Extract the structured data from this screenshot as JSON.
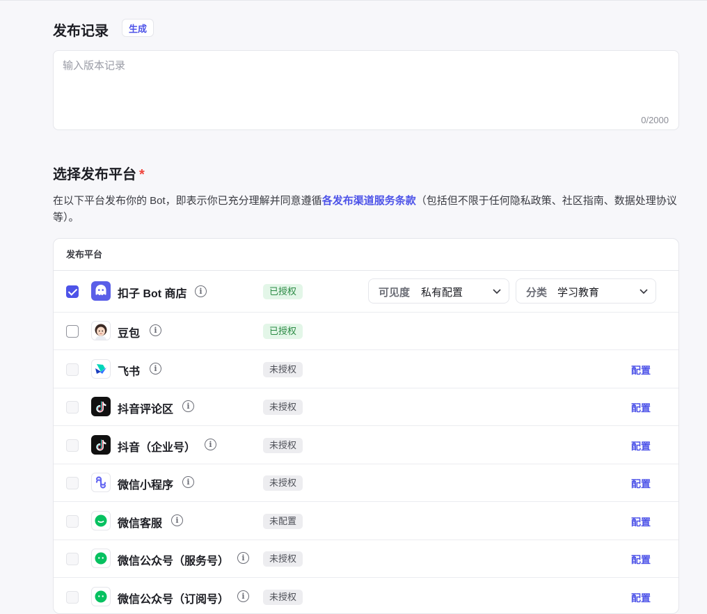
{
  "release_notes": {
    "title": "发布记录",
    "generate_label": "生成",
    "placeholder": "输入版本记录",
    "counter": "0/2000"
  },
  "platform_section": {
    "title": "选择发布平台",
    "required_mark": "*",
    "description_before": "在以下平台发布你的 Bot，即表示你已充分理解并同意遵循",
    "terms_link": "各发布渠道服务条款",
    "description_after": "（包括但不限于任何隐私政策、社区指南、数据处理协议等）。",
    "table_header": "发布平台",
    "config_label": "配置",
    "visibility": {
      "label": "可见度",
      "value": "私有配置"
    },
    "category": {
      "label": "分类",
      "value": "学习教育"
    },
    "platforms": [
      {
        "name": "扣子 Bot 商店",
        "status": "已授权",
        "checked": true,
        "icon": "coze-bot-icon"
      },
      {
        "name": "豆包",
        "status": "已授权",
        "checked": false,
        "icon": "doubao-avatar-icon"
      },
      {
        "name": "飞书",
        "status": "未授权",
        "checked": false,
        "icon": "feishu-icon"
      },
      {
        "name": "抖音评论区",
        "status": "未授权",
        "checked": false,
        "icon": "douyin-icon"
      },
      {
        "name": "抖音（企业号）",
        "status": "未授权",
        "checked": false,
        "icon": "douyin-icon"
      },
      {
        "name": "微信小程序",
        "status": "未授权",
        "checked": false,
        "icon": "wechat-miniprogram-icon"
      },
      {
        "name": "微信客服",
        "status": "未配置",
        "checked": false,
        "icon": "wechat-service-icon"
      },
      {
        "name": "微信公众号（服务号）",
        "status": "未授权",
        "checked": false,
        "icon": "wechat-official-icon"
      },
      {
        "name": "微信公众号（订阅号）",
        "status": "未授权",
        "checked": false,
        "icon": "wechat-official-icon"
      }
    ],
    "colors": {
      "accent": "#4d53e8",
      "authorized_bg": "#e3f6e8",
      "authorized_text": "#2a8a43",
      "unauthorized_bg": "#ededf0",
      "required": "#f0453d"
    }
  }
}
